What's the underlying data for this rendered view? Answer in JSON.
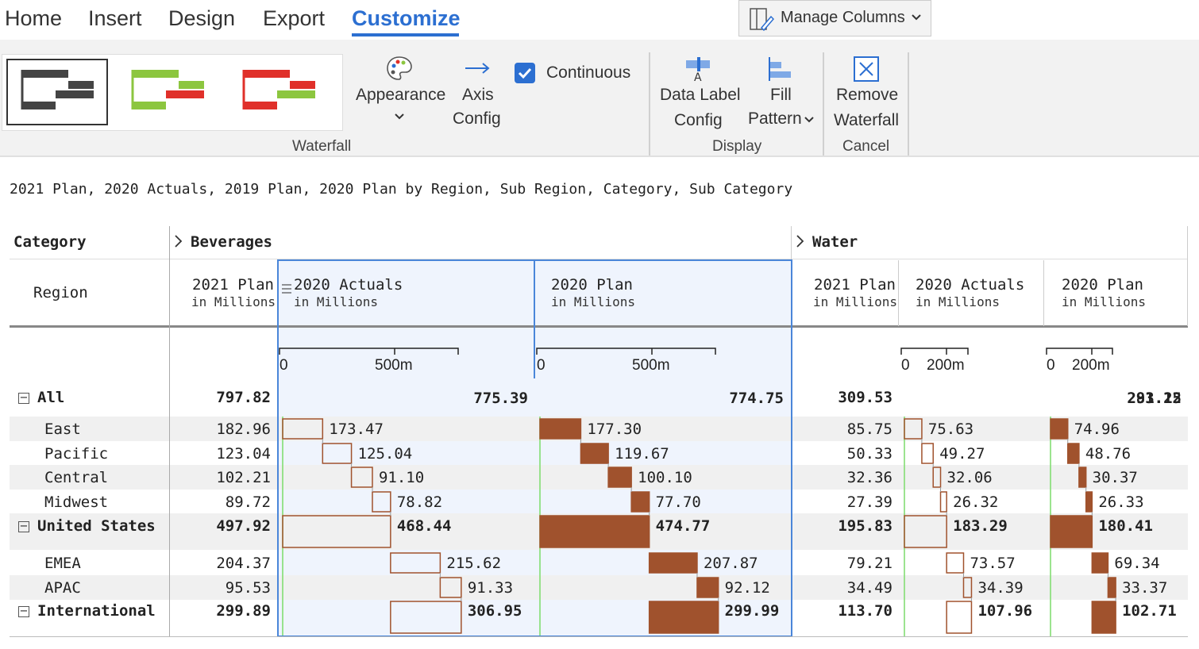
{
  "menu": {
    "tabs": [
      "Home",
      "Insert",
      "Design",
      "Export",
      "Customize"
    ],
    "active_tab": "Customize",
    "manage_columns": "Manage Columns"
  },
  "ribbon": {
    "appearance": "Appearance",
    "axis_config_line1": "Axis",
    "axis_config_line2": "Config",
    "continuous": "Continuous",
    "continuous_checked": true,
    "data_label_line1": "Data Label",
    "data_label_line2": "Config",
    "fill_line1": "Fill",
    "fill_line2": "Pattern",
    "remove_line1": "Remove",
    "remove_line2": "Waterfall",
    "group_waterfall": "Waterfall",
    "group_display": "Display",
    "group_cancel": "Cancel",
    "colors": {
      "accent": "#2c6fd1",
      "green": "#8cc63f",
      "red": "#e0302a",
      "dark": "#444444",
      "bar": "#a0522d"
    }
  },
  "query": "2021 Plan, 2020 Actuals, 2019 Plan, 2020 Plan by Region, Sub Region, Category, Sub Category",
  "table": {
    "category_label": "Category",
    "region_label": "Region",
    "groups": [
      "Beverages",
      "Water"
    ],
    "unit": "in Millions",
    "columns": [
      "2021 Plan",
      "2020 Actuals",
      "2020 Plan",
      "2021 Plan",
      "2020 Actuals",
      "2020 Plan"
    ],
    "axis_ticks": {
      "zero": "0",
      "bev": "500m",
      "water": "200m"
    },
    "rows": [
      {
        "label": "All",
        "bold": true,
        "collapse": true,
        "indent": false,
        "values": [
          "797.82",
          "775.39",
          "774.75",
          "309.53",
          "291.25",
          "283.12"
        ]
      },
      {
        "label": "East",
        "bold": false,
        "collapse": false,
        "indent": true,
        "values": [
          "182.96",
          "173.47",
          "177.30",
          "85.75",
          "75.63",
          "74.96"
        ]
      },
      {
        "label": "Pacific",
        "bold": false,
        "collapse": false,
        "indent": true,
        "values": [
          "123.04",
          "125.04",
          "119.67",
          "50.33",
          "49.27",
          "48.76"
        ]
      },
      {
        "label": "Central",
        "bold": false,
        "collapse": false,
        "indent": true,
        "values": [
          "102.21",
          "91.10",
          "100.10",
          "32.36",
          "32.06",
          "30.37"
        ]
      },
      {
        "label": "Midwest",
        "bold": false,
        "collapse": false,
        "indent": true,
        "values": [
          "89.72",
          "78.82",
          "77.70",
          "27.39",
          "26.32",
          "26.33"
        ]
      },
      {
        "label": "United States",
        "bold": true,
        "collapse": true,
        "indent": false,
        "values": [
          "497.92",
          "468.44",
          "474.77",
          "195.83",
          "183.29",
          "180.41"
        ]
      },
      {
        "label": "EMEA",
        "bold": false,
        "collapse": false,
        "indent": true,
        "values": [
          "204.37",
          "215.62",
          "207.87",
          "79.21",
          "73.57",
          "69.34"
        ]
      },
      {
        "label": "APAC",
        "bold": false,
        "collapse": false,
        "indent": true,
        "values": [
          "95.53",
          "91.33",
          "92.12",
          "34.49",
          "34.39",
          "33.37"
        ]
      },
      {
        "label": "International",
        "bold": true,
        "collapse": true,
        "indent": false,
        "values": [
          "299.89",
          "306.95",
          "299.99",
          "113.70",
          "107.96",
          "102.71"
        ]
      }
    ]
  }
}
